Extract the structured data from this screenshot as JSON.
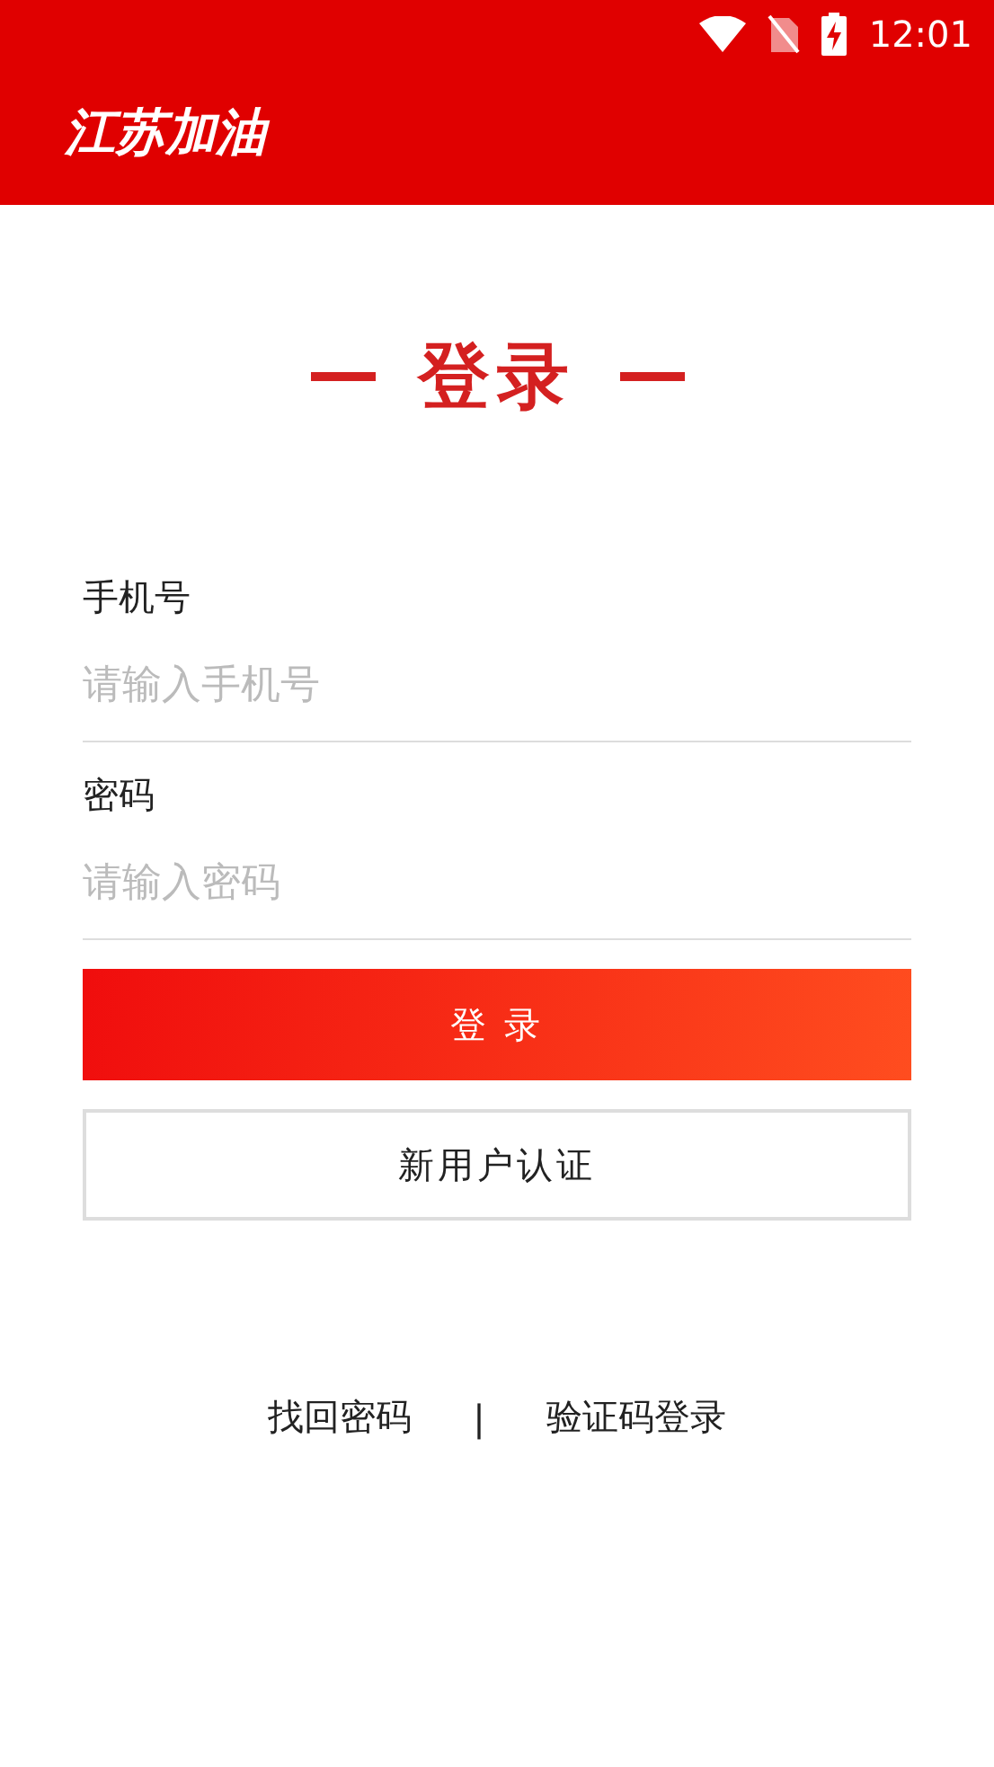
{
  "status_bar": {
    "time": "12:01"
  },
  "header": {
    "title": "江苏加油"
  },
  "page_title": "登录",
  "fields": [
    {
      "label": "手机号",
      "placeholder": "请输入手机号"
    },
    {
      "label": "密码",
      "placeholder": "请输入密码"
    }
  ],
  "buttons": [
    {
      "label": "登 录",
      "kind": "primary"
    },
    {
      "label": "新用户认证",
      "kind": "outline"
    }
  ],
  "links": [
    {
      "label": "找回密码"
    },
    {
      "label": "验证码登录"
    }
  ],
  "separator": "|"
}
